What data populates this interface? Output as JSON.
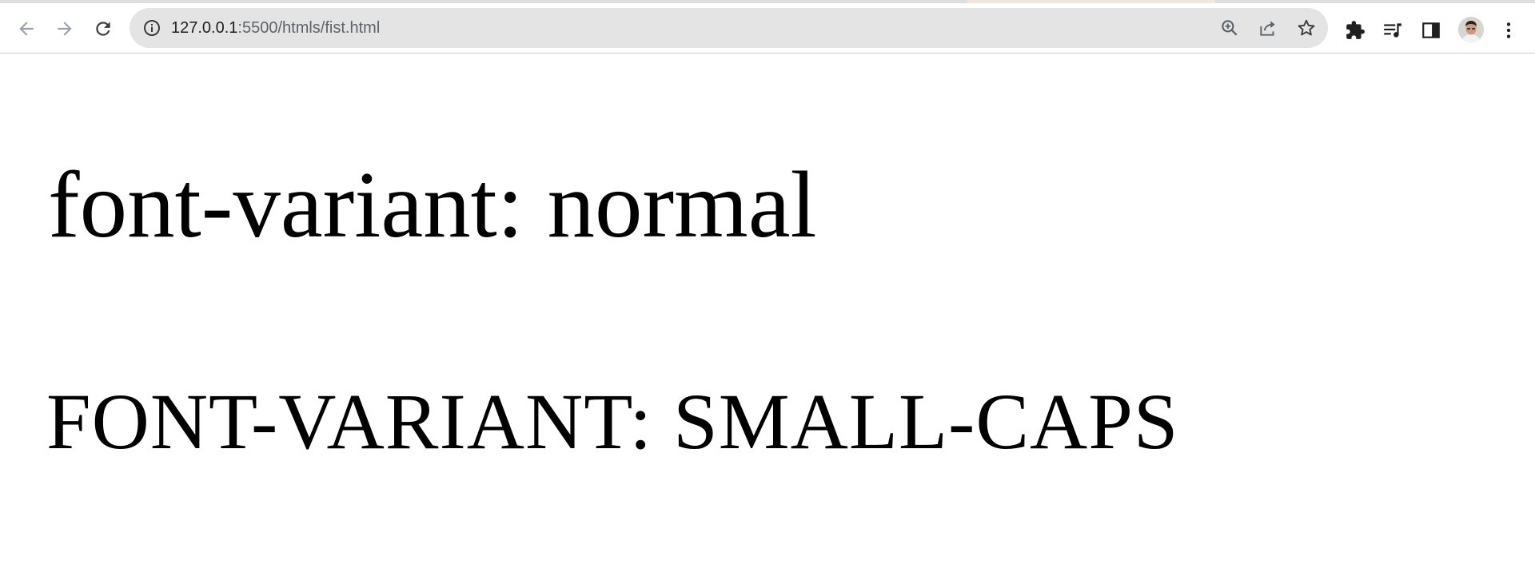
{
  "browser": {
    "url_host": "127.0.0.1",
    "url_rest": ":5500/htmls/fist.html",
    "icons": {
      "back": "arrow-left-icon",
      "forward": "arrow-right-icon",
      "reload": "reload-icon",
      "site_info": "info-icon",
      "zoom": "zoom-in-icon",
      "share": "share-icon",
      "bookmark": "star-icon",
      "extensions": "puzzle-icon",
      "media": "media-queue-icon",
      "side_panel": "side-panel-icon",
      "profile": "avatar",
      "menu": "kebab-menu-icon"
    },
    "colors": {
      "omnibox_bg": "#e4e4e4",
      "icon": "#5f6368",
      "disabled_icon": "#9aa0a6"
    }
  },
  "page": {
    "line_normal": "font-variant: normal",
    "line_small_caps": "font-variant: small-caps"
  }
}
